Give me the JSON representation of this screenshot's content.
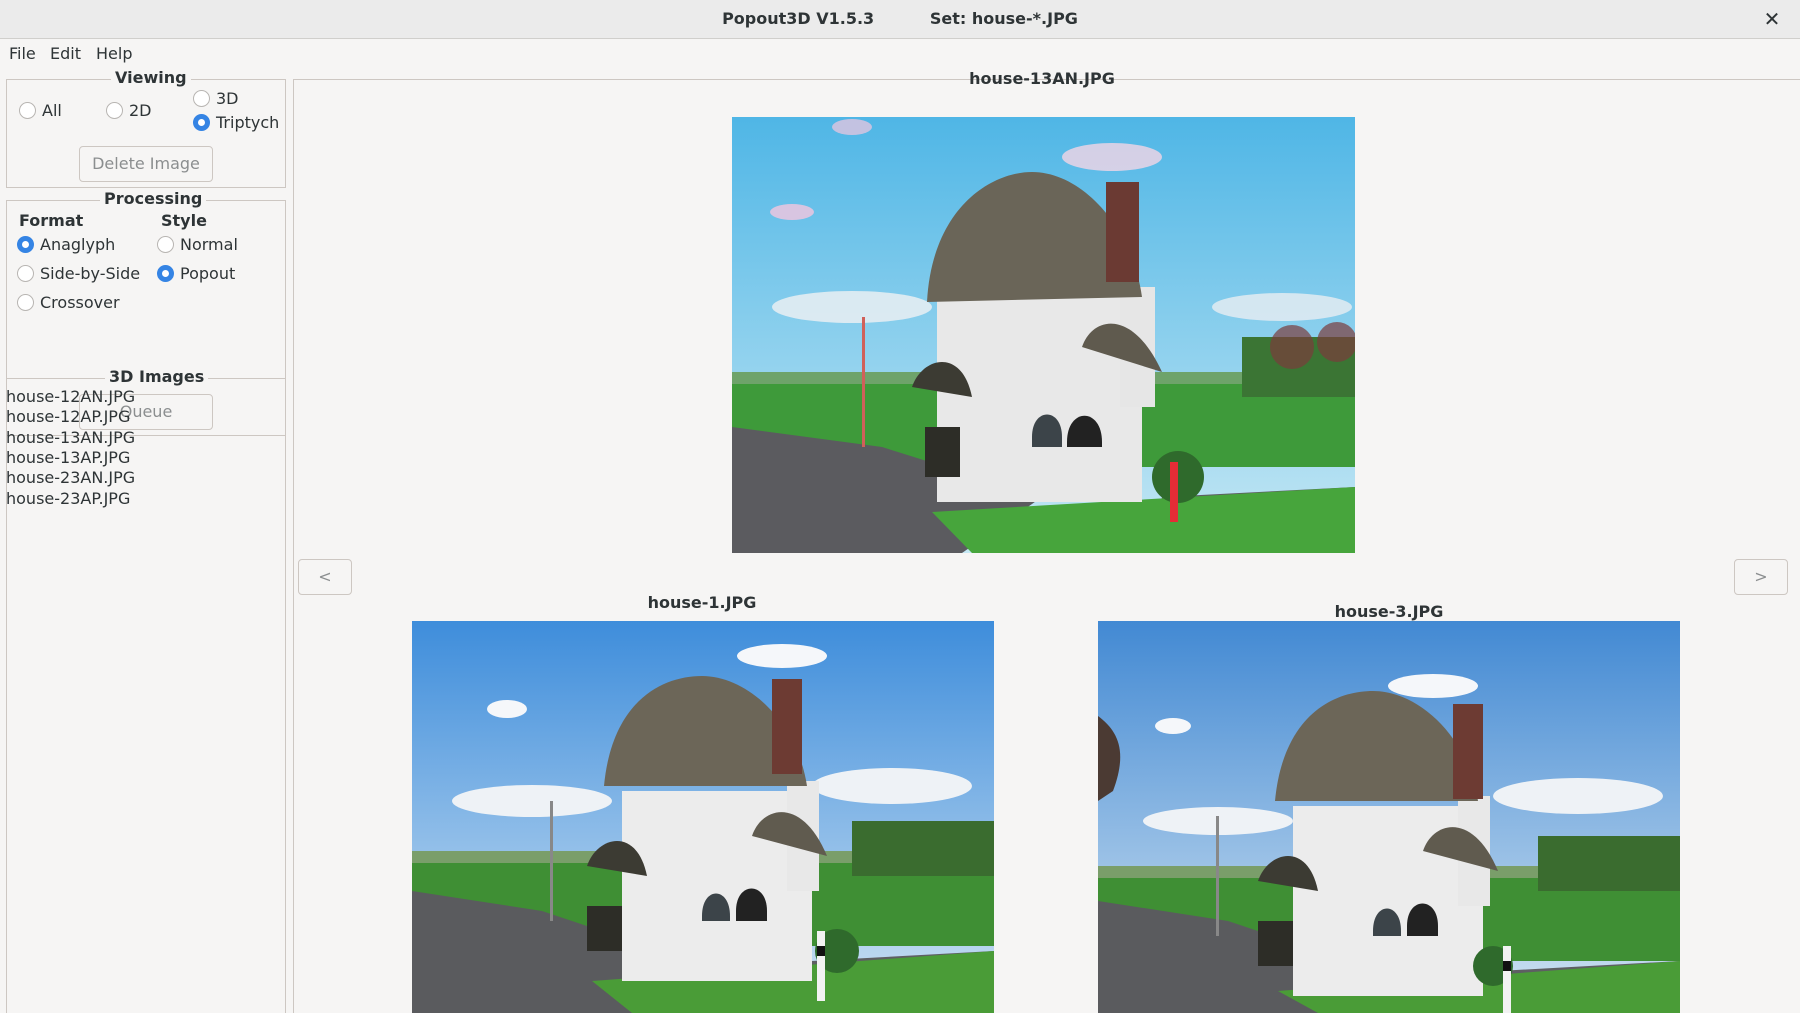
{
  "window": {
    "app_title": "Popout3D V1.5.3",
    "set_label": "Set: house-*.JPG",
    "close_icon": "close-icon"
  },
  "menu": [
    "File",
    "Edit",
    "Help"
  ],
  "viewing": {
    "label": "Viewing",
    "options": {
      "all": "All",
      "2d": "2D",
      "3d": "3D",
      "triptych": "Triptych"
    },
    "selected": "triptych",
    "delete_button": "Delete Image"
  },
  "processing": {
    "label": "Processing",
    "format_header": "Format",
    "style_header": "Style",
    "format_options": {
      "anaglyph": "Anaglyph",
      "side_by_side": "Side-by-Side",
      "crossover": "Crossover"
    },
    "format_selected": "anaglyph",
    "style_options": {
      "normal": "Normal",
      "popout": "Popout"
    },
    "style_selected": "popout",
    "queue_button": "Queue"
  },
  "images_list": {
    "label": "3D Images",
    "items": [
      "house-12AN.JPG",
      "house-12AP.JPG",
      "house-13AN.JPG",
      "house-13AP.JPG",
      "house-23AN.JPG",
      "house-23AP.JPG"
    ]
  },
  "viewer": {
    "top_caption": "house-13AN.JPG",
    "left_caption": "house-1.JPG",
    "right_caption": "house-3.JPG",
    "prev_label": "<",
    "next_label": ">"
  }
}
